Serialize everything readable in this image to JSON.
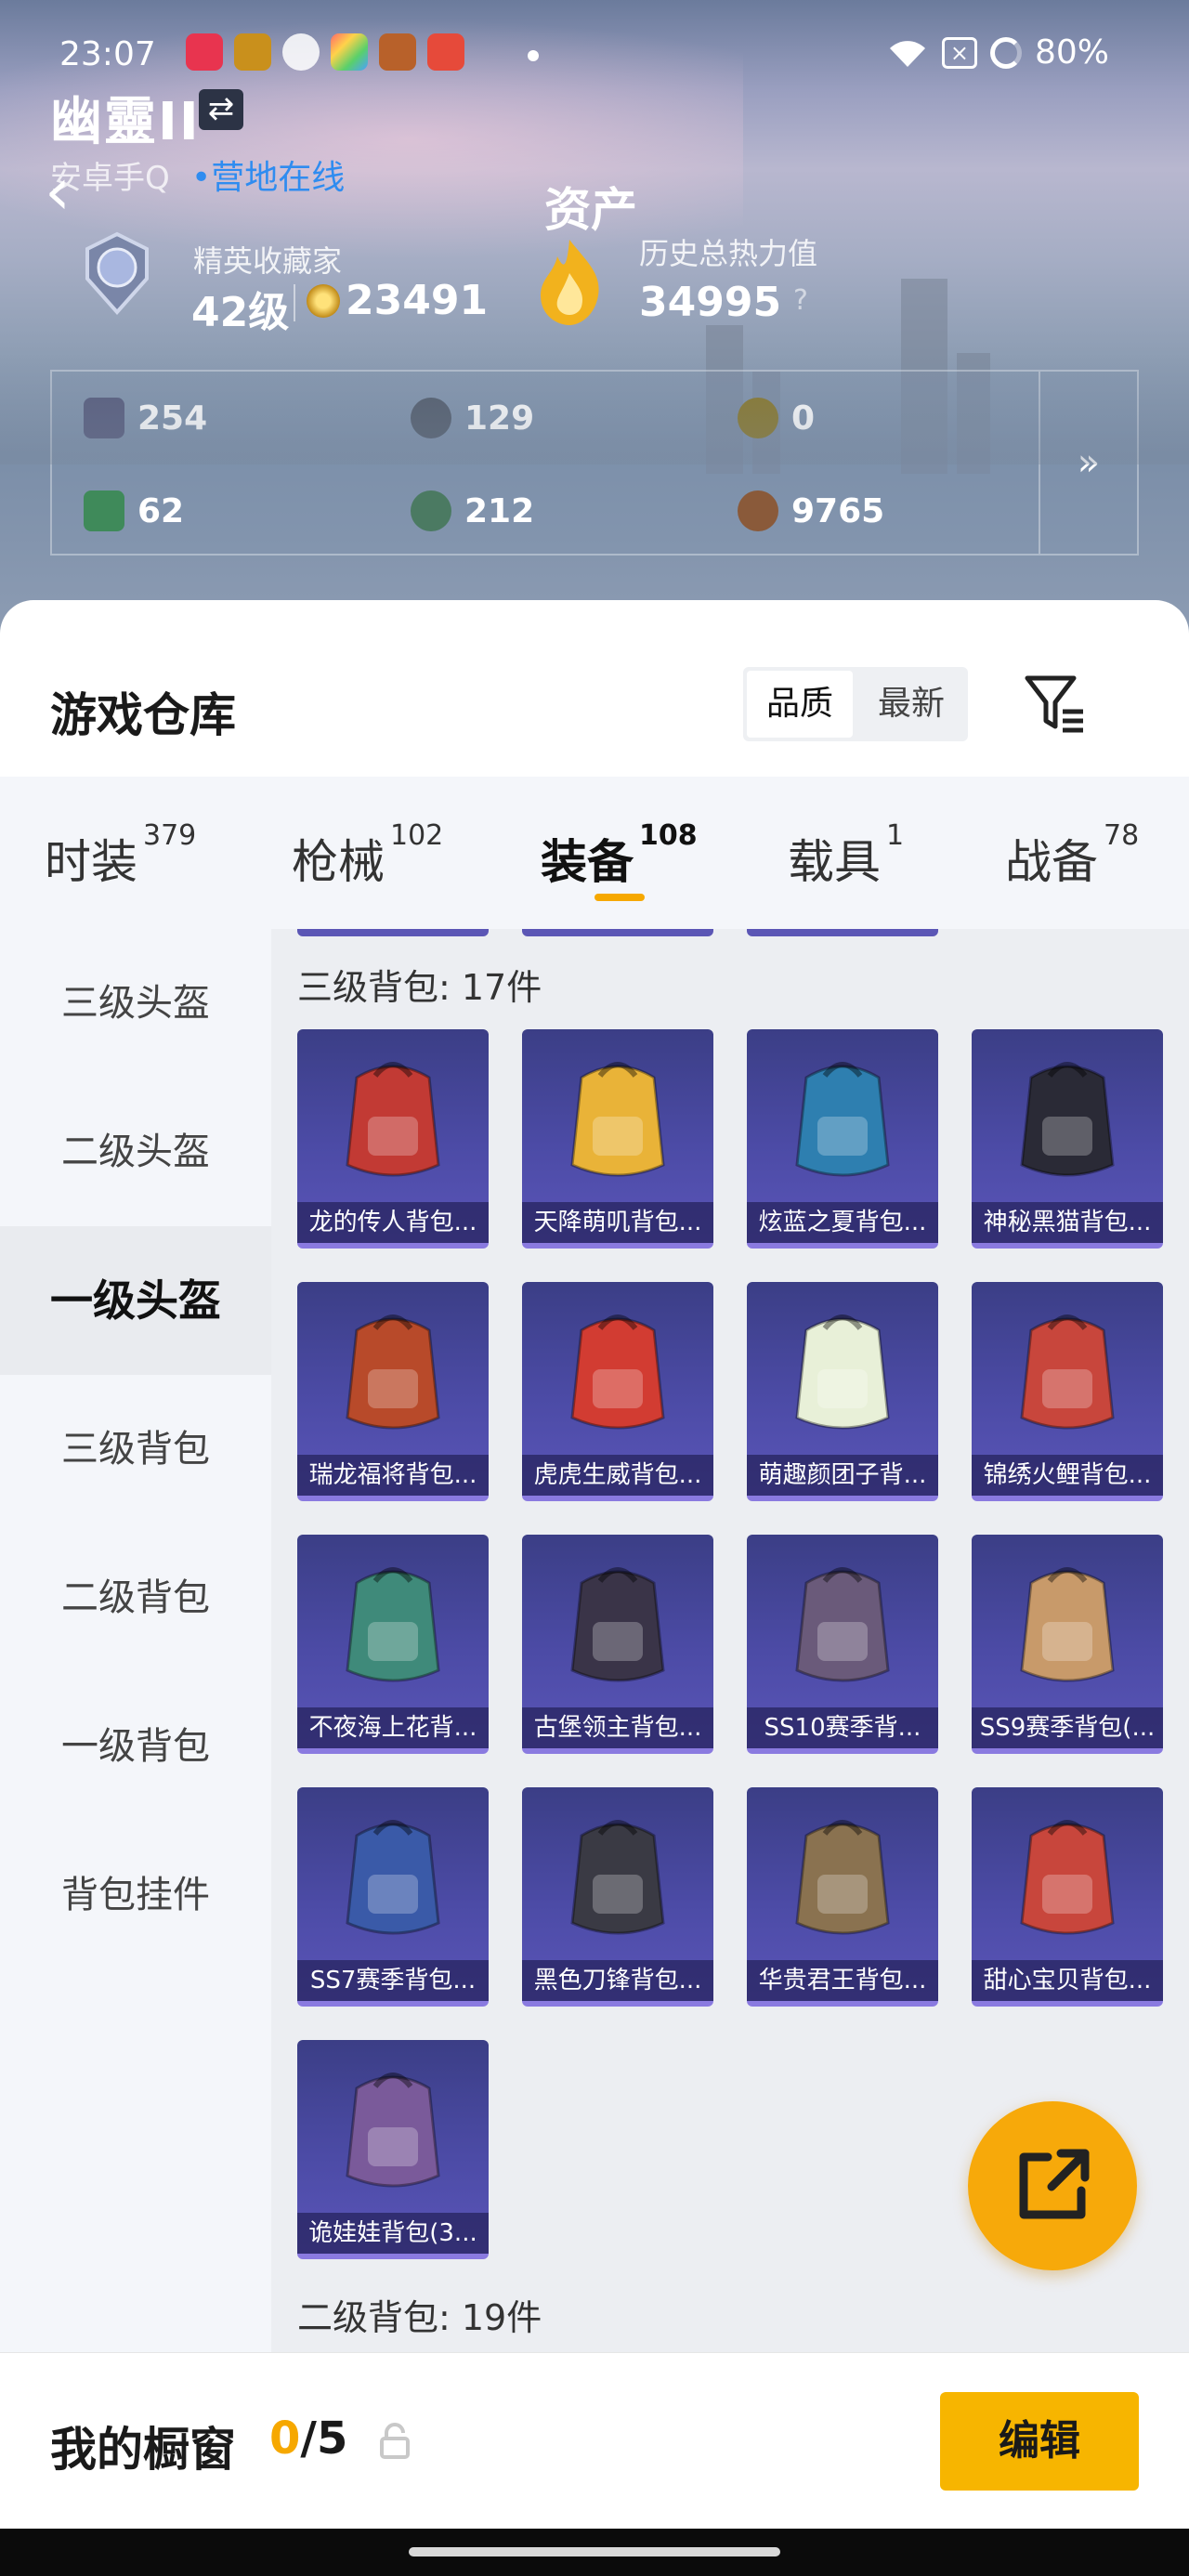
{
  "status_bar": {
    "time": "23:07",
    "apps": [
      {
        "icon": "music-icon",
        "color": "#e8344f"
      },
      {
        "icon": "game-store-icon",
        "color": "#c9901c"
      },
      {
        "icon": "wechat-icon",
        "color": "#ffffff"
      },
      {
        "icon": "gallery-icon",
        "color": "#f0f0f0"
      },
      {
        "icon": "game-app-icon",
        "color": "#b8612a"
      },
      {
        "icon": "video-icon",
        "color": "#e64a3a"
      }
    ],
    "sim_label": "×",
    "battery": "80%"
  },
  "profile": {
    "name": "幽靈II",
    "swap_symbol": "⇄",
    "back_symbol": "‹",
    "platform": "安卓手Q",
    "online_status": "•营地在线",
    "assets_title": "资产",
    "collector_title": "精英收藏家",
    "level": "42级",
    "points": "23491",
    "heat_label": "历史总热力值",
    "heat_value": "34995",
    "heat_help": "?"
  },
  "resources": [
    {
      "icon": "card-icon",
      "value": "254",
      "color": "#5a5f80"
    },
    {
      "icon": "silver-coin-icon",
      "value": "129",
      "color": "#566070"
    },
    {
      "icon": "gold-token-icon",
      "value": "0",
      "color": "#8a7a30"
    },
    {
      "icon": "ticket-icon",
      "value": "62",
      "color": "#3f8a5a"
    },
    {
      "icon": "green-orb-icon",
      "value": "212",
      "color": "#4b7a62"
    },
    {
      "icon": "bronze-coin-icon",
      "value": "9765",
      "color": "#8a5a3a"
    }
  ],
  "resources_more": "»",
  "warehouse": {
    "title": "游戏仓库",
    "sort_options": [
      "品质",
      "最新"
    ],
    "tabs": [
      {
        "label": "时装",
        "count": "379"
      },
      {
        "label": "枪械",
        "count": "102"
      },
      {
        "label": "装备",
        "count": "108"
      },
      {
        "label": "载具",
        "count": "1"
      },
      {
        "label": "战备",
        "count": "78"
      }
    ],
    "side_items": [
      "三级头盔",
      "二级头盔",
      "一级头盔",
      "三级背包",
      "二级背包",
      "一级背包",
      "背包挂件"
    ],
    "sections": [
      {
        "heading": "三级背包: 17件",
        "items": [
          {
            "label": "龙的传人背包...",
            "color": "#c23a34"
          },
          {
            "label": "天降萌叽背包...",
            "color": "#e9b338"
          },
          {
            "label": "炫蓝之夏背包...",
            "color": "#2e7fb0"
          },
          {
            "label": "神秘黑猫背包...",
            "color": "#2a2a36"
          },
          {
            "label": "瑞龙福将背包...",
            "color": "#b84a2a"
          },
          {
            "label": "虎虎生威背包...",
            "color": "#d23c32"
          },
          {
            "label": "萌趣颜团子背...",
            "color": "#e8f0d8"
          },
          {
            "label": "锦绣火鲤背包...",
            "color": "#c8463c"
          },
          {
            "label": "不夜海上花背...",
            "color": "#3f8a7a"
          },
          {
            "label": "古堡领主背包...",
            "color": "#3a3448"
          },
          {
            "label": "SS10赛季背...",
            "color": "#6a5a7a"
          },
          {
            "label": "SS9赛季背包(...",
            "color": "#c89a6a"
          },
          {
            "label": "SS7赛季背包...",
            "color": "#3a5aa8"
          },
          {
            "label": "黑色刀锋背包...",
            "color": "#3a3a44"
          },
          {
            "label": "华贵君王背包...",
            "color": "#8a7250"
          },
          {
            "label": "甜心宝贝背包...",
            "color": "#c8463c"
          },
          {
            "label": "诡娃娃背包(3...",
            "color": "#7a5a9a"
          }
        ]
      },
      {
        "heading": "二级背包: 19件",
        "items": []
      }
    ]
  },
  "fab_icon": "share-icon",
  "showcase": {
    "label": "我的橱窗",
    "current": "0",
    "total": "/5",
    "edit_label": "编辑"
  }
}
